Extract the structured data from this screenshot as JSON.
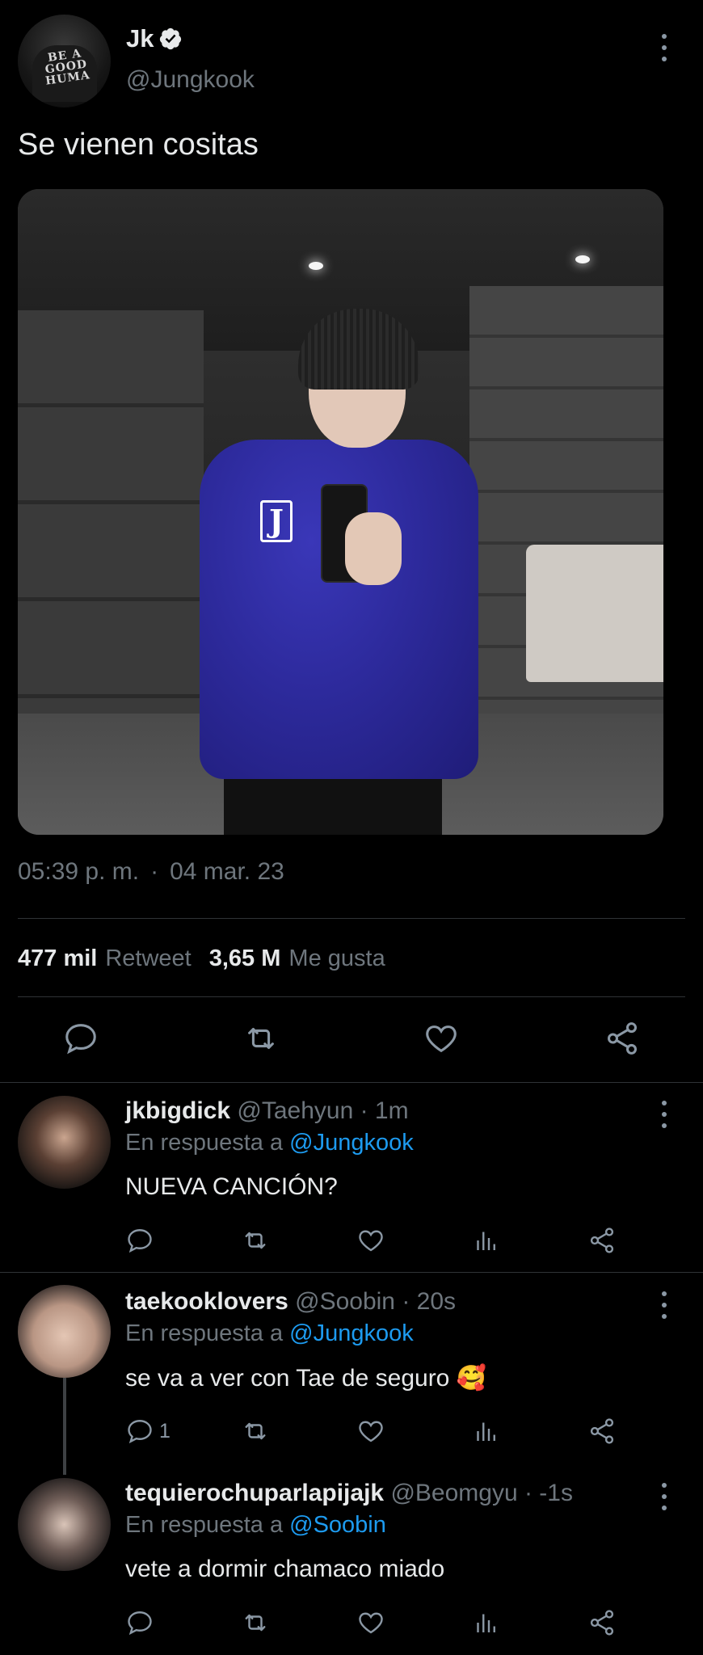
{
  "main_tweet": {
    "author_name": "Jk",
    "author_handle": "@Jungkook",
    "avatar_text": "BE A GOOD HUMA",
    "text": "Se vienen cositas",
    "time": "05:39 p. m.",
    "separator": "·",
    "date": "04 mar. 23",
    "retweets_count": "477 mil",
    "retweets_label": "Retweet",
    "likes_count": "3,65 M",
    "likes_label": "Me gusta",
    "photo_letter": "J"
  },
  "replies": [
    {
      "name": "jkbigdick",
      "handle": "@Taehyun · 1m",
      "reply_to_prefix": "En respuesta a",
      "reply_to_handle": "@Jungkook",
      "text": "NUEVA CANCIÓN?",
      "reply_count": ""
    },
    {
      "name": "taekooklovers",
      "handle": "@Soobin · 20s",
      "reply_to_prefix": "En respuesta a",
      "reply_to_handle": "@Jungkook",
      "text": "se va a ver con Tae de seguro 🥰",
      "reply_count": "1"
    },
    {
      "name": "tequierochuparlapijajk",
      "handle": "@Beomgyu · -1s",
      "reply_to_prefix": "En respuesta a",
      "reply_to_handle": "@Soobin",
      "text": "vete a dormir chamaco miado",
      "reply_count": ""
    }
  ],
  "colors": {
    "background": "#000000",
    "text": "#e7e9ea",
    "muted": "#6e767d",
    "link": "#1d9bf0",
    "icon": "#8b98a5",
    "divider": "#2f3336"
  },
  "icons": {
    "verified": "verified-badge-icon",
    "more": "kebab-menu-icon",
    "reply": "reply-icon",
    "retweet": "retweet-icon",
    "like": "heart-icon",
    "views": "analytics-icon",
    "share": "share-icon"
  }
}
